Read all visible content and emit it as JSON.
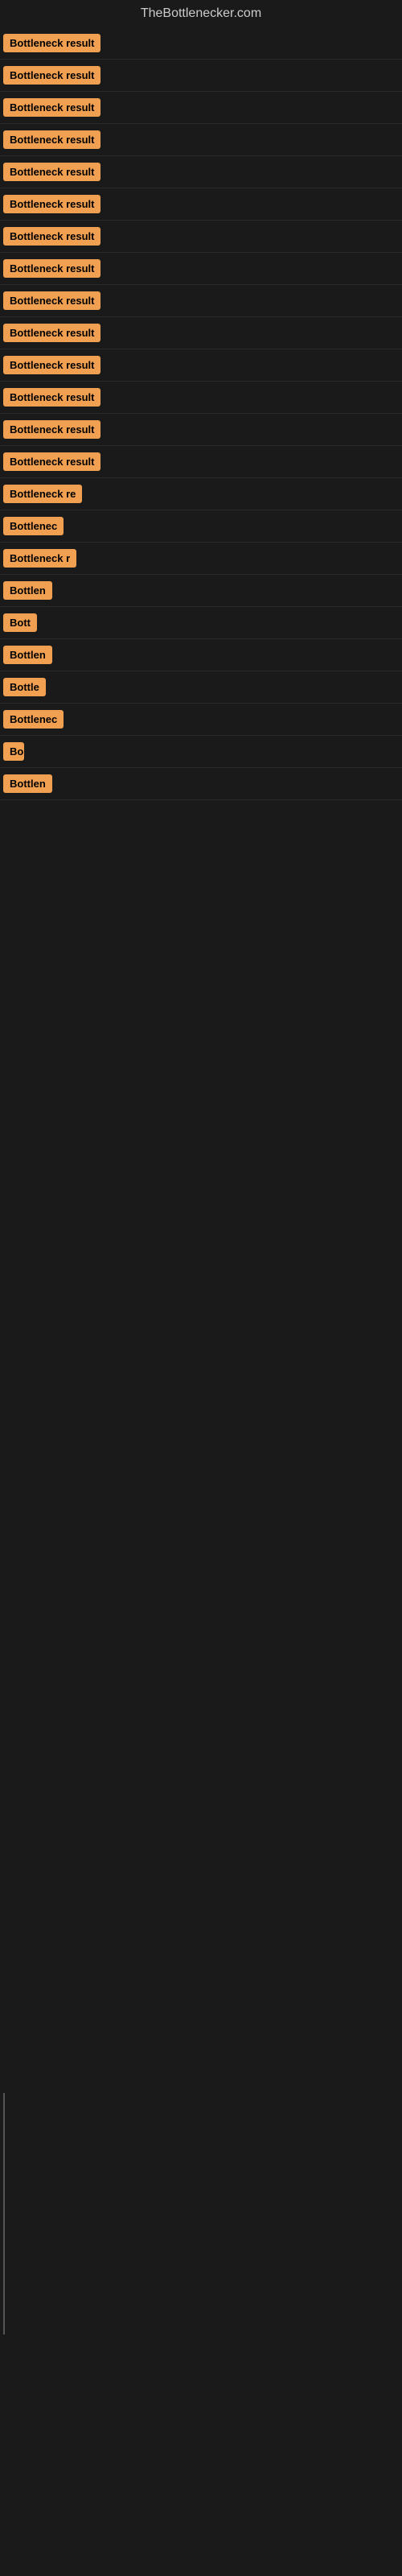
{
  "site": {
    "title": "TheBottlenecker.com"
  },
  "rows": [
    {
      "id": 1,
      "label": "Bottleneck result",
      "width": 130
    },
    {
      "id": 2,
      "label": "Bottleneck result",
      "width": 130
    },
    {
      "id": 3,
      "label": "Bottleneck result",
      "width": 130
    },
    {
      "id": 4,
      "label": "Bottleneck result",
      "width": 130
    },
    {
      "id": 5,
      "label": "Bottleneck result",
      "width": 130
    },
    {
      "id": 6,
      "label": "Bottleneck result",
      "width": 130
    },
    {
      "id": 7,
      "label": "Bottleneck result",
      "width": 130
    },
    {
      "id": 8,
      "label": "Bottleneck result",
      "width": 130
    },
    {
      "id": 9,
      "label": "Bottleneck result",
      "width": 130
    },
    {
      "id": 10,
      "label": "Bottleneck result",
      "width": 130
    },
    {
      "id": 11,
      "label": "Bottleneck result",
      "width": 130
    },
    {
      "id": 12,
      "label": "Bottleneck result",
      "width": 130
    },
    {
      "id": 13,
      "label": "Bottleneck result",
      "width": 130
    },
    {
      "id": 14,
      "label": "Bottleneck result",
      "width": 130
    },
    {
      "id": 15,
      "label": "Bottleneck re",
      "width": 105
    },
    {
      "id": 16,
      "label": "Bottlenec",
      "width": 80
    },
    {
      "id": 17,
      "label": "Bottleneck r",
      "width": 92
    },
    {
      "id": 18,
      "label": "Bottlen",
      "width": 68
    },
    {
      "id": 19,
      "label": "Bott",
      "width": 42
    },
    {
      "id": 20,
      "label": "Bottlen",
      "width": 68
    },
    {
      "id": 21,
      "label": "Bottle",
      "width": 58
    },
    {
      "id": 22,
      "label": "Bottlenec",
      "width": 80
    },
    {
      "id": 23,
      "label": "Bo",
      "width": 26
    },
    {
      "id": 24,
      "label": "Bottlen",
      "width": 68
    }
  ]
}
